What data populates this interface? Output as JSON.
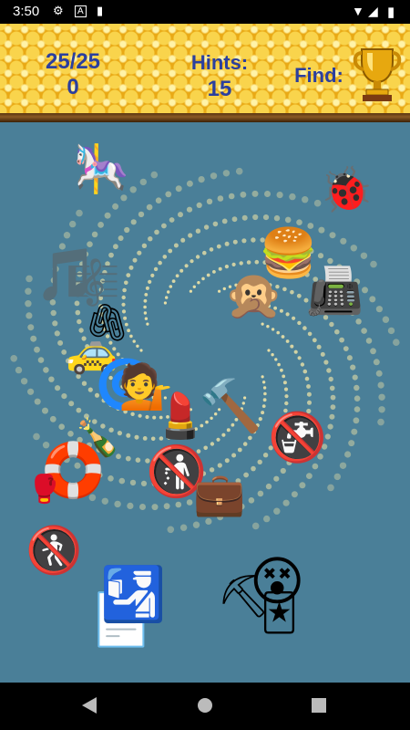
{
  "status_bar": {
    "time": "3:50",
    "icons": [
      "settings-icon",
      "a-notification-icon",
      "sd-card-icon",
      "wifi-icon",
      "signal-icon",
      "battery-icon"
    ]
  },
  "header": {
    "progress": "25/25",
    "score": "0",
    "hints_label": "Hints:",
    "hints_value": "15",
    "find_label": "Find:",
    "trophy_icon": "trophy-icon"
  },
  "colors": {
    "honeycomb": "#f2c12e",
    "header_text": "#2b3f9e",
    "playfield": "#4a7f98",
    "spiral_dots": "#f7e9a8"
  },
  "items": [
    {
      "name": "carousel-horse",
      "glyph": "🎠"
    },
    {
      "name": "lady-beetle",
      "glyph": "🐞"
    },
    {
      "name": "musical-notes",
      "glyph": "🎵"
    },
    {
      "name": "musical-score",
      "glyph": "🎼"
    },
    {
      "name": "hamburger",
      "glyph": "🍔"
    },
    {
      "name": "speak-no-evil-monkey",
      "glyph": "🙊"
    },
    {
      "name": "fax-machine",
      "glyph": "📠"
    },
    {
      "name": "paperclips",
      "glyph": "🖇"
    },
    {
      "name": "taxi",
      "glyph": "🚕"
    },
    {
      "name": "dizzy-symbol",
      "glyph": "🌀"
    },
    {
      "name": "woman-tipping-hand",
      "glyph": "💁"
    },
    {
      "name": "lipstick",
      "glyph": "💄"
    },
    {
      "name": "hammer",
      "glyph": "🔨"
    },
    {
      "name": "non-potable-water",
      "glyph": "🚱"
    },
    {
      "name": "flute-champagne",
      "glyph": "🍾"
    },
    {
      "name": "life-buoy",
      "glyph": "🛟"
    },
    {
      "name": "boxing-glove",
      "glyph": "🥊"
    },
    {
      "name": "no-littering",
      "glyph": "🚯"
    },
    {
      "name": "briefcase",
      "glyph": "💼"
    },
    {
      "name": "no-pedestrians",
      "glyph": "🚷"
    },
    {
      "name": "passport-control",
      "glyph": "🛂"
    },
    {
      "name": "page-facing-up",
      "glyph": "📄"
    },
    {
      "name": "pickaxe-tool",
      "glyph": "⛏"
    },
    {
      "name": "joker-card",
      "glyph": "🃏"
    },
    {
      "name": "confounded-face",
      "glyph": "😵"
    }
  ],
  "nav": {
    "back": "back-icon",
    "home": "home-icon",
    "recents": "recents-icon"
  }
}
